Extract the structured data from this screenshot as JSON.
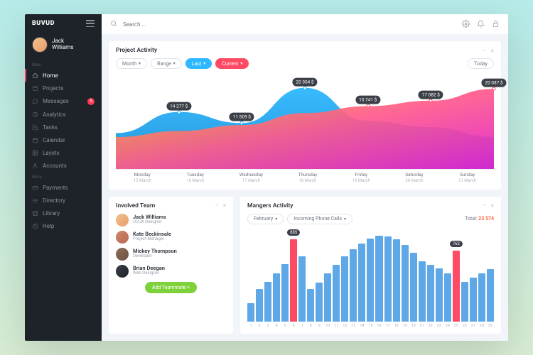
{
  "brand": "BUVUD",
  "user": {
    "first": "Jack",
    "last": "Williams"
  },
  "search": {
    "placeholder": "Search ..."
  },
  "sidebar": {
    "sections": [
      {
        "label": "Main",
        "items": [
          {
            "icon": "home",
            "label": "Home",
            "active": true
          },
          {
            "icon": "projects",
            "label": "Projects"
          },
          {
            "icon": "messages",
            "label": "Messages",
            "badge": "5"
          },
          {
            "icon": "analytics",
            "label": "Analytics"
          },
          {
            "icon": "tasks",
            "label": "Tasks"
          },
          {
            "icon": "calendar",
            "label": "Calendar"
          },
          {
            "icon": "layouts",
            "label": "Layots"
          },
          {
            "icon": "accounts",
            "label": "Accounts"
          }
        ]
      },
      {
        "label": "More",
        "items": [
          {
            "icon": "payments",
            "label": "Payments"
          },
          {
            "icon": "directory",
            "label": "Directory"
          },
          {
            "icon": "library",
            "label": "Library"
          },
          {
            "icon": "help",
            "label": "Help"
          }
        ]
      }
    ]
  },
  "activity": {
    "title": "Project Activity",
    "filters": {
      "month": "Month",
      "range": "Range",
      "last": "Last",
      "current": "Current",
      "today": "Today"
    }
  },
  "chart_data": {
    "type": "area",
    "title": "Project Activity",
    "xlabel": "",
    "ylabel": "$",
    "ylim": [
      0,
      24000
    ],
    "categories": [
      {
        "day": "Monday",
        "date": "15 March"
      },
      {
        "day": "Tuesday",
        "date": "16 March"
      },
      {
        "day": "Wednesday",
        "date": "17 March"
      },
      {
        "day": "Thursday",
        "date": "18 March"
      },
      {
        "day": "Friday",
        "date": "19 March"
      },
      {
        "day": "Saturday",
        "date": "20 March"
      },
      {
        "day": "Sunday",
        "date": "21 March"
      }
    ],
    "series": [
      {
        "name": "Last",
        "color": "#2eb8ff",
        "values": [
          9000,
          14277,
          11509,
          20304,
          12000,
          10500,
          8000
        ]
      },
      {
        "name": "Current",
        "color": "#ff4a64",
        "values": [
          8000,
          9500,
          11000,
          14000,
          15741,
          17082,
          20037
        ]
      }
    ],
    "labels": [
      {
        "x": 1,
        "text": "14 277 $",
        "series": 0
      },
      {
        "x": 2,
        "text": "11 509 $",
        "series": 0
      },
      {
        "x": 3,
        "text": "20 304 $",
        "series": 0
      },
      {
        "x": 4,
        "text": "15 741 $",
        "series": 1
      },
      {
        "x": 5,
        "text": "17 082 $",
        "series": 1
      },
      {
        "x": 6,
        "text": "20 037 $",
        "series": 1
      }
    ]
  },
  "team": {
    "title": "Involved Team",
    "members": [
      {
        "name": "Jack Williams",
        "role": "UI/UX Designer"
      },
      {
        "name": "Kate Beckinsale",
        "role": "Project Manager"
      },
      {
        "name": "Mickey Thompson",
        "role": "Developer"
      },
      {
        "name": "Brian Deegan",
        "role": "Web Designer"
      }
    ],
    "add": "Add Teammate +"
  },
  "managers": {
    "title": "Mangers Activity",
    "filters": {
      "month": "February",
      "metric": "Incoming Phone Calls"
    },
    "total_label": "Total:",
    "total_value": "23 574"
  },
  "managers_chart": {
    "type": "bar",
    "categories": [
      1,
      2,
      3,
      4,
      5,
      6,
      7,
      8,
      9,
      10,
      11,
      12,
      13,
      14,
      15,
      16,
      17,
      18,
      19,
      20,
      21,
      22,
      23,
      24,
      25,
      26,
      27,
      28,
      29
    ],
    "values": [
      200,
      350,
      430,
      520,
      620,
      885,
      700,
      350,
      420,
      520,
      610,
      700,
      780,
      840,
      890,
      920,
      910,
      880,
      820,
      740,
      650,
      610,
      570,
      520,
      762,
      430,
      470,
      520,
      560
    ],
    "highlights": [
      {
        "index": 5,
        "label": "885"
      },
      {
        "index": 24,
        "label": "762"
      }
    ],
    "ylim": [
      0,
      1000
    ]
  }
}
